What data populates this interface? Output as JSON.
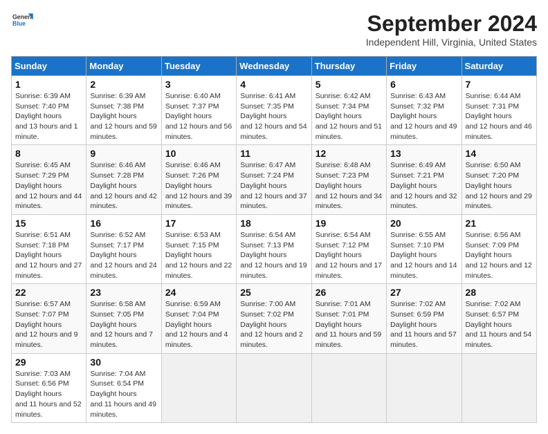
{
  "header": {
    "logo_line1": "General",
    "logo_line2": "Blue",
    "month": "September 2024",
    "location": "Independent Hill, Virginia, United States"
  },
  "weekdays": [
    "Sunday",
    "Monday",
    "Tuesday",
    "Wednesday",
    "Thursday",
    "Friday",
    "Saturday"
  ],
  "weeks": [
    [
      {
        "day": "1",
        "sunrise": "6:39 AM",
        "sunset": "7:40 PM",
        "daylight": "13 hours and 1 minute."
      },
      {
        "day": "2",
        "sunrise": "6:39 AM",
        "sunset": "7:38 PM",
        "daylight": "12 hours and 59 minutes."
      },
      {
        "day": "3",
        "sunrise": "6:40 AM",
        "sunset": "7:37 PM",
        "daylight": "12 hours and 56 minutes."
      },
      {
        "day": "4",
        "sunrise": "6:41 AM",
        "sunset": "7:35 PM",
        "daylight": "12 hours and 54 minutes."
      },
      {
        "day": "5",
        "sunrise": "6:42 AM",
        "sunset": "7:34 PM",
        "daylight": "12 hours and 51 minutes."
      },
      {
        "day": "6",
        "sunrise": "6:43 AM",
        "sunset": "7:32 PM",
        "daylight": "12 hours and 49 minutes."
      },
      {
        "day": "7",
        "sunrise": "6:44 AM",
        "sunset": "7:31 PM",
        "daylight": "12 hours and 46 minutes."
      }
    ],
    [
      {
        "day": "8",
        "sunrise": "6:45 AM",
        "sunset": "7:29 PM",
        "daylight": "12 hours and 44 minutes."
      },
      {
        "day": "9",
        "sunrise": "6:46 AM",
        "sunset": "7:28 PM",
        "daylight": "12 hours and 42 minutes."
      },
      {
        "day": "10",
        "sunrise": "6:46 AM",
        "sunset": "7:26 PM",
        "daylight": "12 hours and 39 minutes."
      },
      {
        "day": "11",
        "sunrise": "6:47 AM",
        "sunset": "7:24 PM",
        "daylight": "12 hours and 37 minutes."
      },
      {
        "day": "12",
        "sunrise": "6:48 AM",
        "sunset": "7:23 PM",
        "daylight": "12 hours and 34 minutes."
      },
      {
        "day": "13",
        "sunrise": "6:49 AM",
        "sunset": "7:21 PM",
        "daylight": "12 hours and 32 minutes."
      },
      {
        "day": "14",
        "sunrise": "6:50 AM",
        "sunset": "7:20 PM",
        "daylight": "12 hours and 29 minutes."
      }
    ],
    [
      {
        "day": "15",
        "sunrise": "6:51 AM",
        "sunset": "7:18 PM",
        "daylight": "12 hours and 27 minutes."
      },
      {
        "day": "16",
        "sunrise": "6:52 AM",
        "sunset": "7:17 PM",
        "daylight": "12 hours and 24 minutes."
      },
      {
        "day": "17",
        "sunrise": "6:53 AM",
        "sunset": "7:15 PM",
        "daylight": "12 hours and 22 minutes."
      },
      {
        "day": "18",
        "sunrise": "6:54 AM",
        "sunset": "7:13 PM",
        "daylight": "12 hours and 19 minutes."
      },
      {
        "day": "19",
        "sunrise": "6:54 AM",
        "sunset": "7:12 PM",
        "daylight": "12 hours and 17 minutes."
      },
      {
        "day": "20",
        "sunrise": "6:55 AM",
        "sunset": "7:10 PM",
        "daylight": "12 hours and 14 minutes."
      },
      {
        "day": "21",
        "sunrise": "6:56 AM",
        "sunset": "7:09 PM",
        "daylight": "12 hours and 12 minutes."
      }
    ],
    [
      {
        "day": "22",
        "sunrise": "6:57 AM",
        "sunset": "7:07 PM",
        "daylight": "12 hours and 9 minutes."
      },
      {
        "day": "23",
        "sunrise": "6:58 AM",
        "sunset": "7:05 PM",
        "daylight": "12 hours and 7 minutes."
      },
      {
        "day": "24",
        "sunrise": "6:59 AM",
        "sunset": "7:04 PM",
        "daylight": "12 hours and 4 minutes."
      },
      {
        "day": "25",
        "sunrise": "7:00 AM",
        "sunset": "7:02 PM",
        "daylight": "12 hours and 2 minutes."
      },
      {
        "day": "26",
        "sunrise": "7:01 AM",
        "sunset": "7:01 PM",
        "daylight": "11 hours and 59 minutes."
      },
      {
        "day": "27",
        "sunrise": "7:02 AM",
        "sunset": "6:59 PM",
        "daylight": "11 hours and 57 minutes."
      },
      {
        "day": "28",
        "sunrise": "7:02 AM",
        "sunset": "6:57 PM",
        "daylight": "11 hours and 54 minutes."
      }
    ],
    [
      {
        "day": "29",
        "sunrise": "7:03 AM",
        "sunset": "6:56 PM",
        "daylight": "11 hours and 52 minutes."
      },
      {
        "day": "30",
        "sunrise": "7:04 AM",
        "sunset": "6:54 PM",
        "daylight": "11 hours and 49 minutes."
      },
      null,
      null,
      null,
      null,
      null
    ]
  ]
}
